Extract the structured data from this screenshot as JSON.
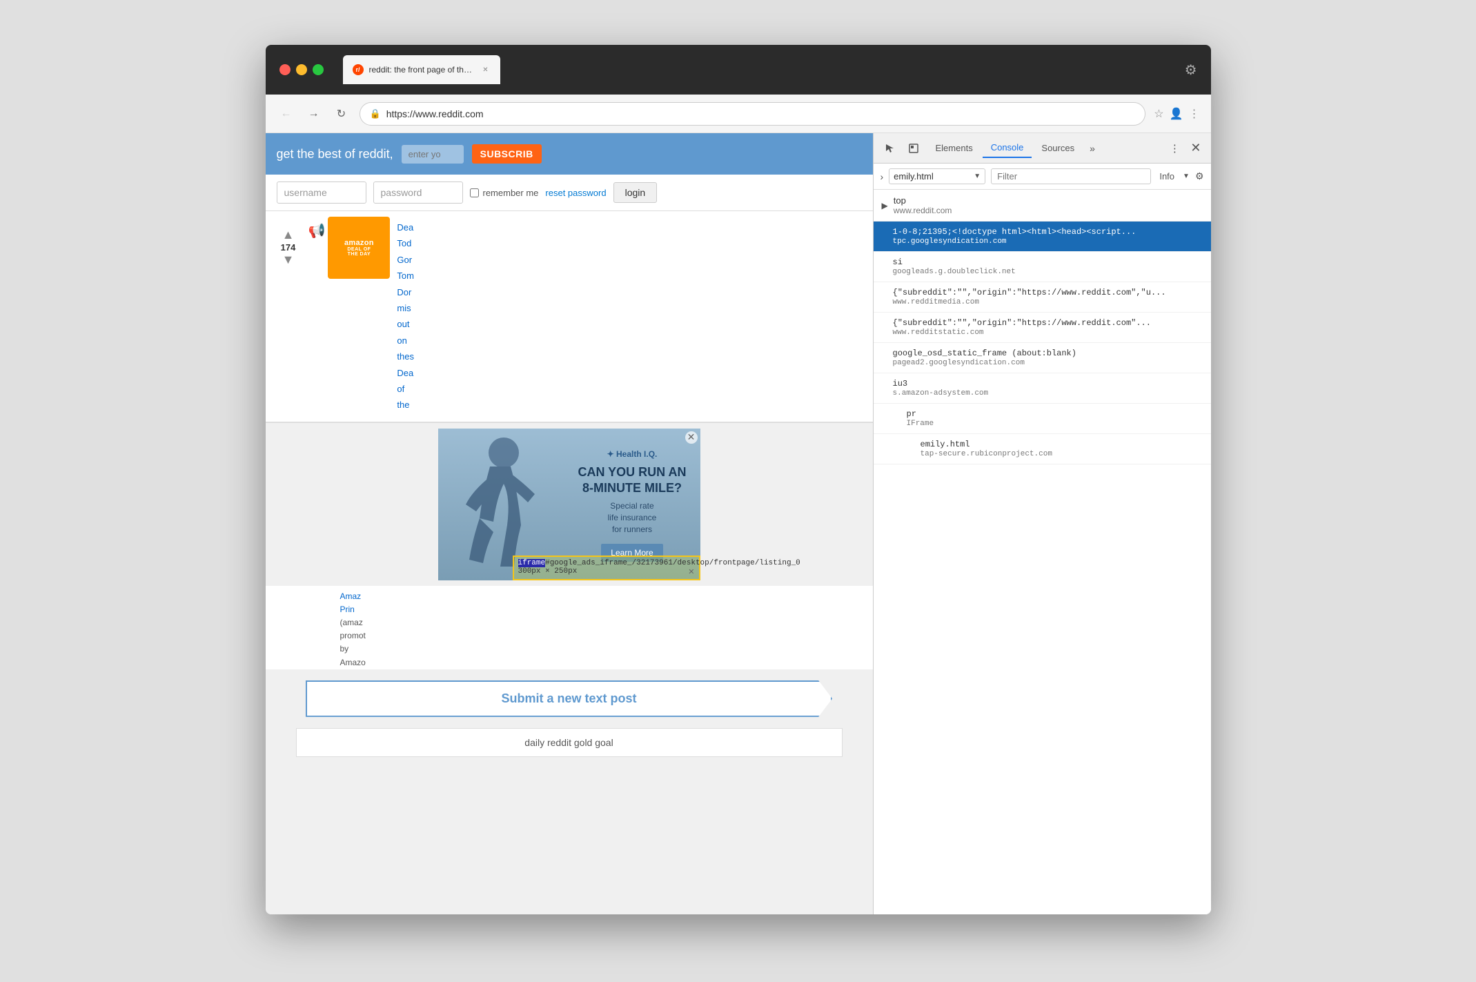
{
  "browser": {
    "title_bar": {
      "tab_title": "reddit: the front page of the in",
      "tab_favicon": "r",
      "url": "https://www.reddit.com",
      "devtools_icon": "⚙"
    },
    "traffic_lights": {
      "red": "#ff5f57",
      "yellow": "#febc2e",
      "green": "#28c840"
    }
  },
  "reddit": {
    "header_text": "get the best of reddit,",
    "enter_email_placeholder": "enter yo",
    "subscribe_label": "SUBSCRIB",
    "login": {
      "username_placeholder": "username",
      "password_placeholder": "password",
      "remember_me_label": "remember me",
      "reset_password_label": "reset password",
      "login_button": "login"
    },
    "post": {
      "vote_count": "174",
      "amazon_deal_lines": [
        "Dea",
        "Tod",
        "Gor",
        "Tom",
        "Dor",
        "mis",
        "out",
        "on",
        "thes",
        "Dea",
        "of",
        "the"
      ],
      "amazon_badge_lines": [
        "amazon",
        "DEAL OF",
        "THE DAY"
      ]
    },
    "ad": {
      "logo": "Health I.Q.",
      "headline": "CAN YOU RUN AN\n8-MINUTE MILE?",
      "subtext": "Special rate\nlife insurance\nfor runners",
      "learn_more": "Learn More"
    },
    "iframe_label": "iframe#google_ads_iframe_/32173961/desktop/frontpage/listing_0 300px × 250px",
    "submit_post": "Submit a new text post",
    "gold_goal": "daily reddit gold goal",
    "amazon_promo": "Amaz\nPrin\n(amaz\npromot\nby\nAmazo"
  },
  "devtools": {
    "tabs": [
      "Elements",
      "Console",
      "Sources"
    ],
    "active_tab": "Console",
    "more_tabs": "»",
    "toolbar": {
      "pointer_icon": "↖",
      "box_icon": "□",
      "more_icon": "⋮",
      "close_icon": "✕"
    },
    "console": {
      "caret": "›",
      "context_selector": "emily.html",
      "filter_placeholder": "Filter",
      "info_label": "Info",
      "entries": [
        {
          "type": "top_level",
          "indent": 0,
          "name": "top",
          "origin": "www.reddit.com",
          "has_arrow": true,
          "selected": false
        },
        {
          "type": "frame",
          "indent": 1,
          "name": "1-0-8;21395;<doctype html><html><head><script...",
          "origin": "tpc.googlesyndication.com",
          "selected": true
        },
        {
          "type": "frame",
          "indent": 1,
          "name": "si",
          "origin": "googleads.g.doubleclick.net",
          "selected": false
        },
        {
          "type": "frame",
          "indent": 1,
          "name": "{\"subreddit\":\"\",\"origin\":\"https://www.reddit.com\",\"u...",
          "origin": "www.redditmedia.com",
          "selected": false
        },
        {
          "type": "frame",
          "indent": 1,
          "name": "{\"subreddit\":\"\",\"origin\":\"https://www.reddit.com\"...",
          "origin": "www.redditstatic.com",
          "selected": false
        },
        {
          "type": "frame",
          "indent": 1,
          "name": "google_osd_static_frame (about:blank)",
          "origin": "pagead2.googlesyndication.com",
          "selected": false
        },
        {
          "type": "frame",
          "indent": 1,
          "name": "iu3",
          "origin": "s.amazon-adsystem.com",
          "selected": false
        },
        {
          "type": "frame",
          "indent": 2,
          "name": "pr",
          "origin": "IFrame",
          "selected": false
        },
        {
          "type": "frame",
          "indent": 3,
          "name": "emily.html",
          "origin": "tap-secure.rubiconproject.com",
          "selected": false
        }
      ]
    }
  }
}
